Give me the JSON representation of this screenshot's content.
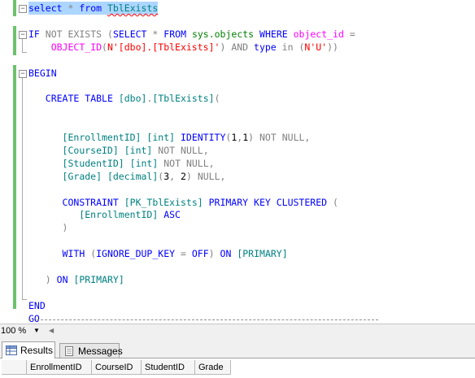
{
  "editor": {
    "lines": [
      [
        [
          "select",
          "kw"
        ],
        [
          " ",
          "plain"
        ],
        [
          "*",
          "op"
        ],
        [
          " ",
          "plain"
        ],
        [
          "from",
          "kw"
        ],
        [
          " ",
          "plain"
        ],
        [
          "TblExists",
          "obj squiggle"
        ]
      ],
      [],
      [
        [
          "IF",
          "kw"
        ],
        [
          " ",
          "plain"
        ],
        [
          "NOT",
          "op"
        ],
        [
          " ",
          "plain"
        ],
        [
          "EXISTS",
          "op"
        ],
        [
          " ",
          "plain"
        ],
        [
          "(",
          "op"
        ],
        [
          "SELECT",
          "kw"
        ],
        [
          " ",
          "plain"
        ],
        [
          "*",
          "op"
        ],
        [
          " ",
          "plain"
        ],
        [
          "FROM",
          "kw"
        ],
        [
          " ",
          "plain"
        ],
        [
          "sys.objects",
          "sys"
        ],
        [
          " ",
          "plain"
        ],
        [
          "WHERE",
          "kw"
        ],
        [
          " ",
          "plain"
        ],
        [
          "object_id",
          "fn"
        ],
        [
          " ",
          "plain"
        ],
        [
          "=",
          "op"
        ]
      ],
      [
        [
          "    ",
          "plain"
        ],
        [
          "OBJECT_ID",
          "fn"
        ],
        [
          "(",
          "op"
        ],
        [
          "N'[dbo].[TblExists]'",
          "str"
        ],
        [
          ")",
          "op"
        ],
        [
          " ",
          "plain"
        ],
        [
          "AND",
          "op"
        ],
        [
          " ",
          "plain"
        ],
        [
          "type",
          "kw"
        ],
        [
          " ",
          "plain"
        ],
        [
          "in",
          "op"
        ],
        [
          " ",
          "plain"
        ],
        [
          "(",
          "op"
        ],
        [
          "N'U'",
          "str"
        ],
        [
          "))",
          "op"
        ]
      ],
      [],
      [
        [
          "BEGIN",
          "kw"
        ]
      ],
      [],
      [
        [
          "   ",
          "plain"
        ],
        [
          "CREATE",
          "kw"
        ],
        [
          " ",
          "plain"
        ],
        [
          "TABLE",
          "kw"
        ],
        [
          " ",
          "plain"
        ],
        [
          "[dbo]",
          "obj"
        ],
        [
          ".",
          "op"
        ],
        [
          "[TblExists]",
          "obj"
        ],
        [
          "(",
          "op"
        ]
      ],
      [],
      [],
      [
        [
          "      ",
          "plain"
        ],
        [
          "[EnrollmentID]",
          "obj"
        ],
        [
          " ",
          "plain"
        ],
        [
          "[int]",
          "obj"
        ],
        [
          " ",
          "plain"
        ],
        [
          "IDENTITY",
          "kw"
        ],
        [
          "(",
          "op"
        ],
        [
          "1",
          "plain"
        ],
        [
          ",",
          "op"
        ],
        [
          "1",
          "plain"
        ],
        [
          ")",
          "op"
        ],
        [
          " ",
          "plain"
        ],
        [
          "NOT",
          "op"
        ],
        [
          " ",
          "plain"
        ],
        [
          "NULL",
          "op"
        ],
        [
          ",",
          "op"
        ]
      ],
      [
        [
          "      ",
          "plain"
        ],
        [
          "[CourseID]",
          "obj"
        ],
        [
          " ",
          "plain"
        ],
        [
          "[int]",
          "obj"
        ],
        [
          " ",
          "plain"
        ],
        [
          "NOT",
          "op"
        ],
        [
          " ",
          "plain"
        ],
        [
          "NULL",
          "op"
        ],
        [
          ",",
          "op"
        ]
      ],
      [
        [
          "      ",
          "plain"
        ],
        [
          "[StudentID]",
          "obj"
        ],
        [
          " ",
          "plain"
        ],
        [
          "[int]",
          "obj"
        ],
        [
          " ",
          "plain"
        ],
        [
          "NOT",
          "op"
        ],
        [
          " ",
          "plain"
        ],
        [
          "NULL",
          "op"
        ],
        [
          ",",
          "op"
        ]
      ],
      [
        [
          "      ",
          "plain"
        ],
        [
          "[Grade]",
          "obj"
        ],
        [
          " ",
          "plain"
        ],
        [
          "[decimal]",
          "obj"
        ],
        [
          "(",
          "op"
        ],
        [
          "3",
          "plain"
        ],
        [
          ",",
          "op"
        ],
        [
          " ",
          "plain"
        ],
        [
          "2",
          "plain"
        ],
        [
          ")",
          "op"
        ],
        [
          " ",
          "plain"
        ],
        [
          "NULL",
          "op"
        ],
        [
          ",",
          "op"
        ]
      ],
      [],
      [
        [
          "      ",
          "plain"
        ],
        [
          "CONSTRAINT",
          "kw"
        ],
        [
          " ",
          "plain"
        ],
        [
          "[PK_TblExists]",
          "obj"
        ],
        [
          " ",
          "plain"
        ],
        [
          "PRIMARY",
          "kw"
        ],
        [
          " ",
          "plain"
        ],
        [
          "KEY",
          "kw"
        ],
        [
          " ",
          "plain"
        ],
        [
          "CLUSTERED",
          "kw"
        ],
        [
          " ",
          "plain"
        ],
        [
          "(",
          "op"
        ]
      ],
      [
        [
          "         ",
          "plain"
        ],
        [
          "[EnrollmentID]",
          "obj"
        ],
        [
          " ",
          "plain"
        ],
        [
          "ASC",
          "kw"
        ]
      ],
      [
        [
          "      ",
          "plain"
        ],
        [
          ")",
          "op"
        ]
      ],
      [],
      [
        [
          "      ",
          "plain"
        ],
        [
          "WITH",
          "kw"
        ],
        [
          " ",
          "plain"
        ],
        [
          "(",
          "op"
        ],
        [
          "IGNORE_DUP_KEY",
          "kw"
        ],
        [
          " ",
          "plain"
        ],
        [
          "=",
          "op"
        ],
        [
          " ",
          "plain"
        ],
        [
          "OFF",
          "kw"
        ],
        [
          ")",
          "op"
        ],
        [
          " ",
          "plain"
        ],
        [
          "ON",
          "kw"
        ],
        [
          " ",
          "plain"
        ],
        [
          "[PRIMARY]",
          "obj"
        ]
      ],
      [],
      [
        [
          "   ",
          "plain"
        ],
        [
          ")",
          "op"
        ],
        [
          " ",
          "plain"
        ],
        [
          "ON",
          "kw"
        ],
        [
          " ",
          "plain"
        ],
        [
          "[PRIMARY]",
          "obj"
        ]
      ],
      [],
      [
        [
          "END",
          "kw"
        ]
      ],
      [
        [
          "GO",
          "kw"
        ]
      ]
    ]
  },
  "statusbar": {
    "zoom_value": "100 %"
  },
  "results_tabs": {
    "results_label": "Results",
    "messages_label": "Messages"
  },
  "grid": {
    "columns": [
      "EnrollmentID",
      "CourseID",
      "StudentID",
      "Grade"
    ]
  },
  "colors": {
    "keyword": "#0000ff",
    "operator": "#808080",
    "function": "#ff00ff",
    "string": "#ff0000",
    "object": "#008080",
    "system_object": "#008000",
    "selection": "#add6ff",
    "change_bar": "#6cc36c"
  },
  "icons": {
    "results_tab": "grid-icon",
    "messages_tab": "document-icon",
    "fold_collapse": "minus-box-icon"
  }
}
